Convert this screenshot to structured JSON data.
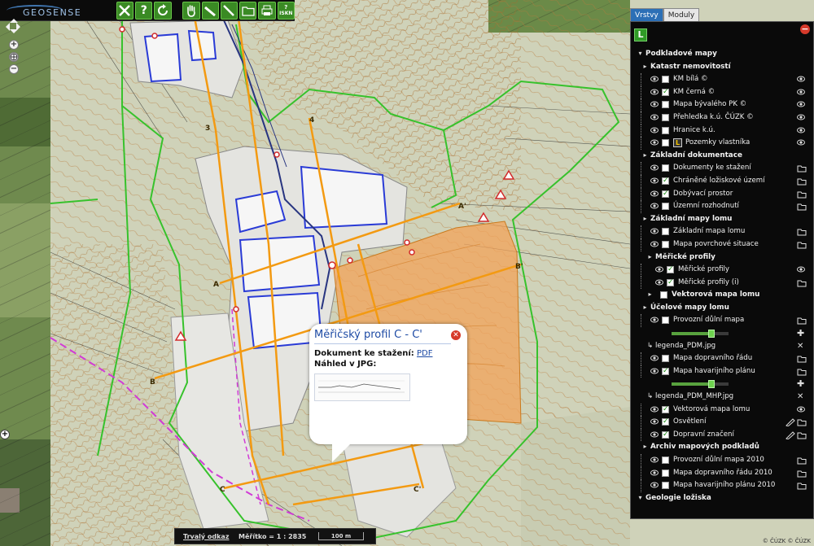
{
  "toolbar": {
    "logo_text": "GEOSENSE",
    "buttons": [
      {
        "name": "tools-button",
        "icon": "tools-icon"
      },
      {
        "name": "help-button",
        "label": "?"
      },
      {
        "name": "refresh-button",
        "icon": "refresh-icon"
      },
      {
        "name": "pan-button",
        "icon": "hand-icon"
      },
      {
        "name": "measure-button",
        "icon": "ruler-icon"
      },
      {
        "name": "draw-button",
        "icon": "pencil-icon"
      },
      {
        "name": "folder-button",
        "icon": "folder-icon"
      },
      {
        "name": "print-button",
        "icon": "printer-icon"
      },
      {
        "name": "iskn-button",
        "label": "ISKN"
      }
    ]
  },
  "popup": {
    "title": "Měřičský profil C - C'",
    "document_label": "Dokument ke stažení:",
    "document_link": "PDF",
    "preview_label": "Náhled v JPG:"
  },
  "scalebar": {
    "permalink": "Trvalý odkaz",
    "scale_label": "Měřítko = 1 : 2835",
    "bar_label": "100 m"
  },
  "credits": "© ČÚZK © ČÚZK",
  "panel": {
    "tabs": [
      "Vrstvy",
      "Moduly"
    ],
    "legend_button": "L",
    "rows": [
      {
        "kind": "group",
        "label": "Podkladové mapy",
        "level": 0
      },
      {
        "kind": "group",
        "label": "Katastr nemovitostí",
        "level": 1
      },
      {
        "kind": "item",
        "label": "KM bílá ©",
        "checked": false,
        "eye": true
      },
      {
        "kind": "item",
        "label": "KM černá ©",
        "checked": true,
        "eye": true
      },
      {
        "kind": "item",
        "label": "Mapa bývalého PK ©",
        "checked": false,
        "eye": true
      },
      {
        "kind": "item",
        "label": "Přehledka k.ú. ČÚZK ©",
        "checked": false,
        "eye": true
      },
      {
        "kind": "item",
        "label": "Hranice k.ú.",
        "checked": false,
        "eye": true
      },
      {
        "kind": "item",
        "label": "Pozemky vlastníka",
        "checked": false,
        "eye": true,
        "badge": "L"
      },
      {
        "kind": "group",
        "label": "Základní dokumentace",
        "level": 1
      },
      {
        "kind": "item",
        "label": "Dokumenty ke stažení",
        "checked": false,
        "folder": true
      },
      {
        "kind": "item",
        "label": "Chráněné ložiskové území",
        "checked": true,
        "folder": true
      },
      {
        "kind": "item",
        "label": "Dobývací prostor",
        "checked": true,
        "folder": true
      },
      {
        "kind": "item",
        "label": "Územní rozhodnutí",
        "checked": false,
        "folder": true
      },
      {
        "kind": "group",
        "label": "Základní mapy lomu",
        "level": 1
      },
      {
        "kind": "item",
        "label": "Základní mapa lomu",
        "checked": false,
        "folder": true
      },
      {
        "kind": "item",
        "label": "Mapa povrchové situace",
        "checked": false,
        "folder": true
      },
      {
        "kind": "group",
        "label": "Měřické profily",
        "level": 2
      },
      {
        "kind": "item",
        "label": "Měřické profily",
        "checked": true,
        "eye": true,
        "indent": 1
      },
      {
        "kind": "item",
        "label": "Měřické profily (i)",
        "checked": true,
        "folder": true,
        "indent": 1
      },
      {
        "kind": "group",
        "label": "Vektorová mapa lomu",
        "level": 2,
        "checked": false
      },
      {
        "kind": "group",
        "label": "Účelové mapy lomu",
        "level": 1
      },
      {
        "kind": "item",
        "label": "Provozní důlní mapa",
        "checked": false,
        "folder": true
      },
      {
        "kind": "slider",
        "value": 0.7
      },
      {
        "kind": "legend",
        "label": "legenda_PDM.jpg"
      },
      {
        "kind": "item",
        "label": "Mapa dopravního řádu",
        "checked": false,
        "folder": true
      },
      {
        "kind": "item",
        "label": "Mapa havarijního plánu",
        "checked": true,
        "folder": true
      },
      {
        "kind": "slider",
        "value": 0.7
      },
      {
        "kind": "legend",
        "label": "legenda_PDM_MHP.jpg"
      },
      {
        "kind": "item",
        "label": "Vektorová mapa lomu",
        "checked": true,
        "eye": true
      },
      {
        "kind": "item",
        "label": "Osvětlení",
        "checked": true,
        "edit": true
      },
      {
        "kind": "item",
        "label": "Dopravní značení",
        "checked": true,
        "edit": true
      },
      {
        "kind": "group",
        "label": "Archiv mapových podkladů",
        "level": 1
      },
      {
        "kind": "item",
        "label": "Provozní důlní mapa 2010",
        "checked": false,
        "folder": true
      },
      {
        "kind": "item",
        "label": "Mapa dopravního řádu 2010",
        "checked": false,
        "folder": true
      },
      {
        "kind": "item",
        "label": "Mapa havarijního plánu 2010",
        "checked": false,
        "folder": true
      },
      {
        "kind": "group",
        "label": "Geologie ložiska",
        "level": 0
      }
    ]
  },
  "map": {
    "profile_labels": [
      "A",
      "A'",
      "B",
      "B'",
      "C",
      "C'",
      "3",
      "4"
    ],
    "colors": {
      "profile_line": "#f39a12",
      "boundary_green": "#37c22c",
      "boundary_magenta": "#d13bd6",
      "pit_fill": "#f3a35a",
      "water_blue": "#2a3bd6",
      "accent_blue": "#2c6fb6"
    }
  }
}
